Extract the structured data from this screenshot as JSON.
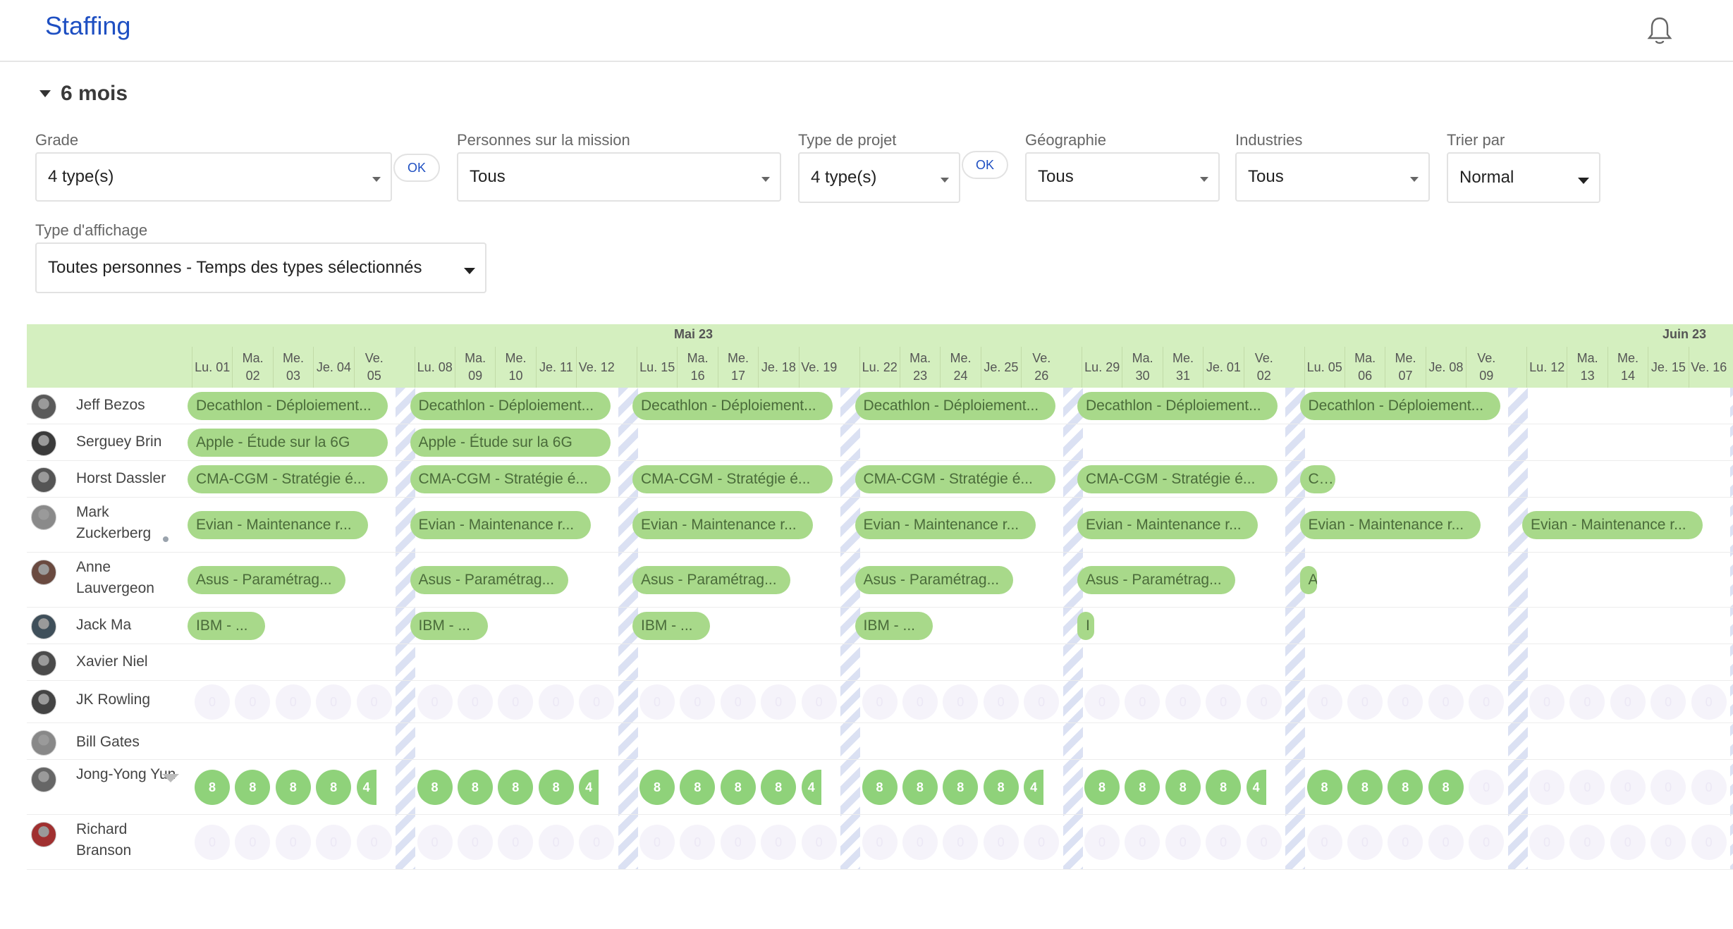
{
  "header": {
    "title": "Staffing",
    "notification_icon": "bell-icon"
  },
  "section": {
    "title": "6 mois"
  },
  "filters": {
    "grade": {
      "label": "Grade",
      "value": "4 type(s)",
      "ok_label": "OK"
    },
    "personnes": {
      "label": "Personnes sur la mission",
      "value": "Tous"
    },
    "type_projet": {
      "label": "Type de projet",
      "value": "4 type(s)",
      "ok_label": "OK"
    },
    "geographie": {
      "label": "Géographie",
      "value": "Tous"
    },
    "industries": {
      "label": "Industries",
      "value": "Tous"
    },
    "trier": {
      "label": "Trier par",
      "value": "Normal"
    },
    "affichage": {
      "label": "Type d'affichage",
      "value": "Toutes personnes - Temps des types sélectionnés"
    }
  },
  "calendar": {
    "months": [
      {
        "label": "Mai 23"
      },
      {
        "label": "Juin 23"
      }
    ],
    "days": [
      "Lu. 01",
      "Ma.\n02",
      "Me.\n03",
      "Je. 04",
      "Ve.\n05",
      "Lu. 08",
      "Ma.\n09",
      "Me.\n10",
      "Je. 11",
      "Ve. 12",
      "Lu. 15",
      "Ma.\n16",
      "Me.\n17",
      "Je. 18",
      "Ve. 19",
      "Lu. 22",
      "Ma.\n23",
      "Me.\n24",
      "Je. 25",
      "Ve.\n26",
      "Lu. 29",
      "Ma.\n30",
      "Me.\n31",
      "Je. 01",
      "Ve.\n02",
      "Lu. 05",
      "Ma.\n06",
      "Me.\n07",
      "Je. 08",
      "Ve.\n09",
      "Lu. 12",
      "Ma.\n13",
      "Me.\n14",
      "Je. 15",
      "Ve. 16"
    ]
  },
  "people": [
    {
      "name": "Jeff Bezos",
      "avatar_color": "#5a5a5a"
    },
    {
      "name": "Serguey Brin",
      "avatar_color": "#3a3a3a"
    },
    {
      "name": "Horst Dassler",
      "avatar_color": "#555555"
    },
    {
      "name": "Mark Zuckerberg",
      "avatar_color": "#8a8a8a"
    },
    {
      "name": "Anne Lauvergeon",
      "avatar_color": "#6a4a40"
    },
    {
      "name": "Jack Ma",
      "avatar_color": "#3f4f5a"
    },
    {
      "name": "Xavier Niel",
      "avatar_color": "#4a4a4a"
    },
    {
      "name": "JK Rowling",
      "avatar_color": "#444444"
    },
    {
      "name": "Bill Gates",
      "avatar_color": "#888888"
    },
    {
      "name": "Jong-Yong Yun",
      "avatar_color": "#666666"
    },
    {
      "name": "Richard Branson",
      "avatar_color": "#a03030"
    }
  ],
  "assignments": {
    "decathlon": "Decathlon - Déploiement...",
    "apple": "Apple - Étude sur la 6G",
    "cma": "CMA-CGM - Stratégie é...",
    "cma_short": "C...",
    "evian": "Evian - Maintenance r...",
    "asus": "Asus - Paramétrag...",
    "asus_short": "A",
    "ibm": "IBM - ...",
    "ibm_short": "I"
  },
  "circles": {
    "value": "8",
    "partial": "4",
    "empty": "0"
  },
  "colors": {
    "accent": "#1e4fc2",
    "header_green": "#d4efbf",
    "pill_green": "#a8d98a",
    "circle_green": "#8fd27a"
  }
}
